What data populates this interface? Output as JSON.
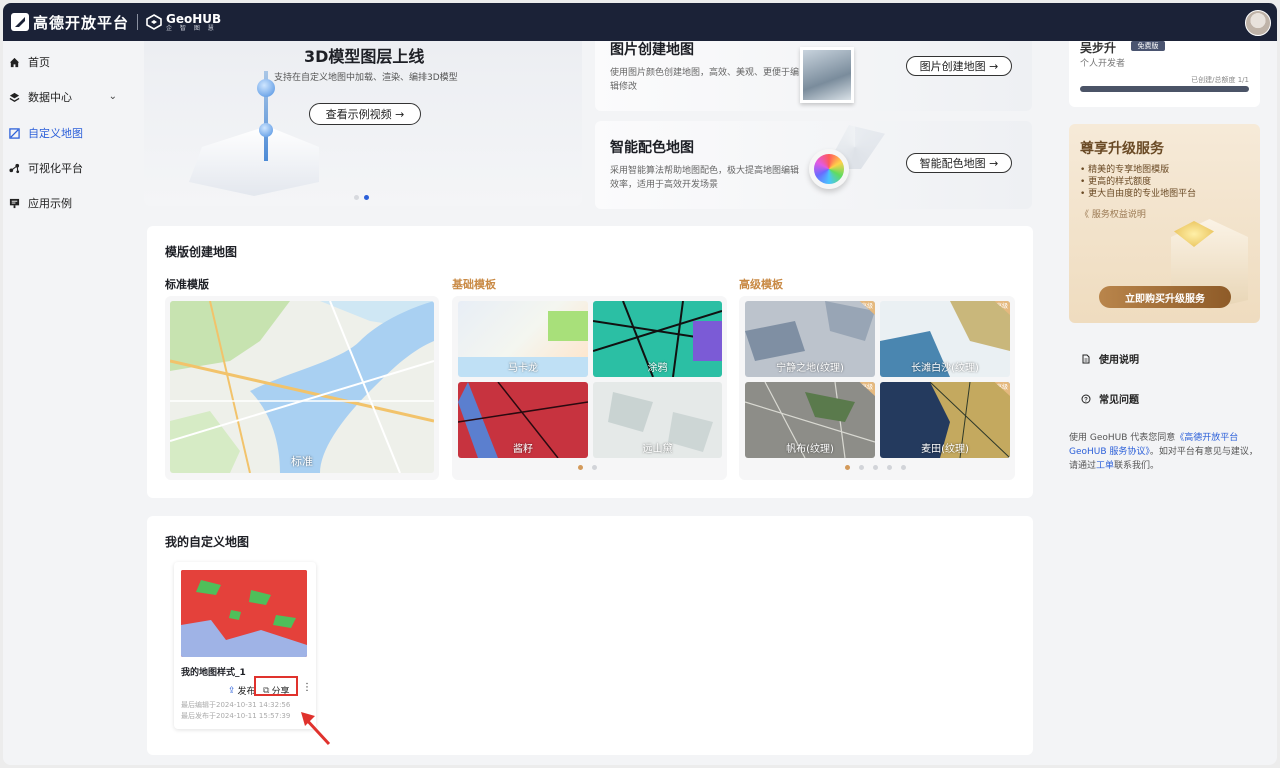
{
  "app": {
    "brand": "高德开放平台",
    "product": "GeoHUB",
    "product_sub": "企 智 图 慧"
  },
  "sidebar": {
    "items": [
      {
        "label": "首页",
        "icon": "home-icon"
      },
      {
        "label": "数据中心",
        "icon": "layers-icon"
      },
      {
        "label": "自定义地图",
        "icon": "map-icon",
        "active": true
      },
      {
        "label": "可视化平台",
        "icon": "chart-icon"
      },
      {
        "label": "应用示例",
        "icon": "monitor-icon"
      }
    ]
  },
  "hero": {
    "title": "3D模型图层上线",
    "desc": "支持在自定义地图中加载、渲染、编排3D模型",
    "button": "查看示例视频 →",
    "active_slide": 2,
    "slide_count": 2
  },
  "features": [
    {
      "title": "图片创建地图",
      "desc": "使用图片颜色创建地图，高效、美观、更便于编辑修改",
      "button": "图片创建地图 →"
    },
    {
      "title": "智能配色地图",
      "desc": "采用智能算法帮助地图配色，极大提高地图编辑效率，适用于高效开发场景",
      "button": "智能配色地图 →"
    }
  ],
  "templates": {
    "title": "模版创建地图",
    "groups": [
      {
        "title": "标准模版",
        "tiles": [
          "标准"
        ]
      },
      {
        "title": "基础模板",
        "tiles": [
          "马卡龙",
          "涂鸦",
          "酱籽",
          "远山黛"
        ]
      },
      {
        "title": "高级模板",
        "tiles": [
          "宁静之地(纹理)",
          "长滩白沙(纹理)",
          "帆布(纹理)",
          "麦田(纹理)"
        ]
      }
    ],
    "premium_badge": "高级"
  },
  "my_maps": {
    "title": "我的自定义地图",
    "items": [
      {
        "name": "我的地图样式_1",
        "publish": "发布",
        "share": "分享",
        "last_edit": "最后编辑于2024-10-31 14:32:56",
        "last_publish": "最后发布于2024-10-11 15:57:39"
      }
    ]
  },
  "account": {
    "name": "吴步升",
    "tag": "免费版",
    "role": "个人开发者",
    "quota_text": "已创建/总额度 1/1",
    "quota_used": 1,
    "quota_total": 1
  },
  "upgrade": {
    "title": "尊享升级服务",
    "features": [
      "精美的专享地图模版",
      "更高的样式额度",
      "更大自由度的专业地图平台"
    ],
    "link": "《 服务权益说明",
    "button": "立即购买升级服务"
  },
  "help": {
    "guide": "使用说明",
    "faq": "常见问题"
  },
  "terms": {
    "prefix": "使用 GeoHUB 代表您同意",
    "link": "《高德开放平台GeoHUB 服务协议》",
    "middle": "。如对平台有意见与建议，请通过",
    "ticket": "工单",
    "suffix": "联系我们。"
  },
  "colors": {
    "topbar": "#1b2237",
    "accent": "#2b5fd9",
    "highlight": "#e0322d",
    "gold": "#d39a5b"
  }
}
